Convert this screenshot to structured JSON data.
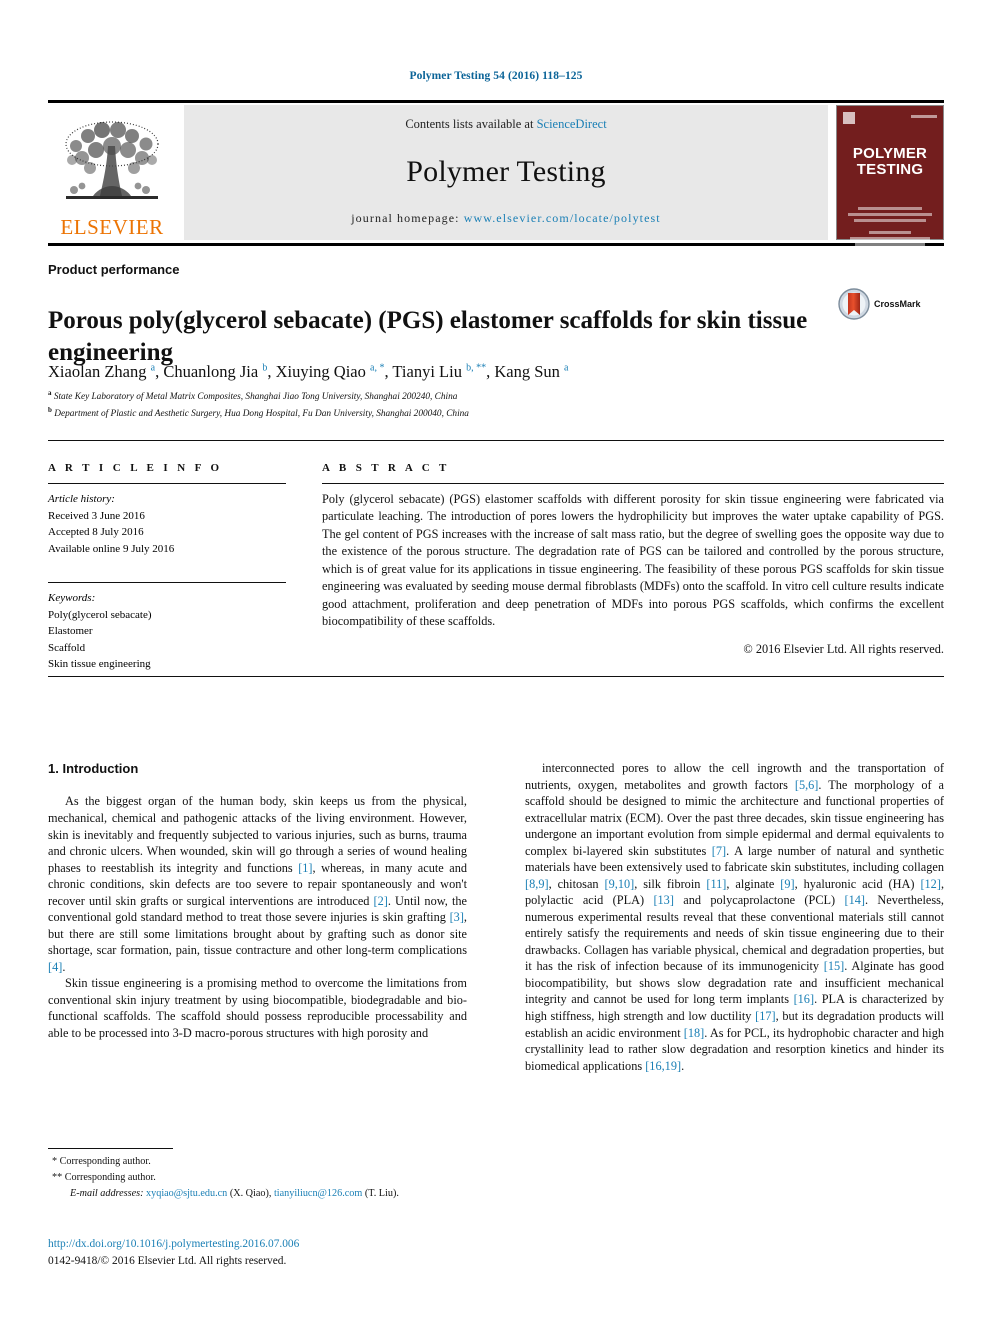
{
  "running_head": "Polymer Testing 54 (2016) 118–125",
  "masthead": {
    "contents_prefix": "Contents lists available at ",
    "contents_link": "ScienceDirect",
    "journal_name": "Polymer Testing",
    "homepage_prefix": "journal homepage: ",
    "homepage_url": "www.elsevier.com/locate/polytest",
    "publisher_name": "ELSEVIER",
    "cover_title_line1": "POLYMER",
    "cover_title_line2": "TESTING"
  },
  "section_label": "Product performance",
  "title": "Porous poly(glycerol sebacate) (PGS) elastomer scaffolds for skin tissue engineering",
  "crossmark_label": "CrossMark",
  "authors": [
    {
      "name": "Xiaolan Zhang",
      "marks": "a"
    },
    {
      "name": "Chuanlong Jia",
      "marks": "b"
    },
    {
      "name": "Xiuying Qiao",
      "marks": "a, *"
    },
    {
      "name": "Tianyi Liu",
      "marks": "b, **"
    },
    {
      "name": "Kang Sun",
      "marks": "a"
    }
  ],
  "affiliations": [
    {
      "mark": "a",
      "text": "State Key Laboratory of Metal Matrix Composites, Shanghai Jiao Tong University, Shanghai 200240, China"
    },
    {
      "mark": "b",
      "text": "Department of Plastic and Aesthetic Surgery, Hua Dong Hospital, Fu Dan University, Shanghai 200040, China"
    }
  ],
  "article_info": {
    "heading": "A R T I C L E  I N F O",
    "history_label": "Article history:",
    "history": [
      "Received 3 June 2016",
      "Accepted 8 July 2016",
      "Available online 9 July 2016"
    ],
    "keywords_label": "Keywords:",
    "keywords": [
      "Poly(glycerol sebacate)",
      "Elastomer",
      "Scaffold",
      "Skin tissue engineering"
    ]
  },
  "abstract": {
    "heading": "A B S T R A C T",
    "text": "Poly (glycerol sebacate) (PGS) elastomer scaffolds with different porosity for skin tissue engineering were fabricated via particulate leaching. The introduction of pores lowers the hydrophilicity but improves the water uptake capability of PGS. The gel content of PGS increases with the increase of salt mass ratio, but the degree of swelling goes the opposite way due to the existence of the porous structure. The degradation rate of PGS can be tailored and controlled by the porous structure, which is of great value for its applications in tissue engineering. The feasibility of these porous PGS scaffolds for skin tissue engineering was evaluated by seeding mouse dermal fibroblasts (MDFs) onto the scaffold. In vitro cell culture results indicate good attachment, proliferation and deep penetration of MDFs into porous PGS scaffolds, which confirms the excellent biocompatibility of these scaffolds.",
    "copyright": "© 2016 Elsevier Ltd. All rights reserved."
  },
  "body": {
    "section_heading": "1. Introduction",
    "left_paragraphs": [
      "As the biggest organ of the human body, skin keeps us from the physical, mechanical, chemical and pathogenic attacks of the living environment. However, skin is inevitably and frequently subjected to various injuries, such as burns, trauma and chronic ulcers. When wounded, skin will go through a series of wound healing phases to reestablish its integrity and functions [1], whereas, in many acute and chronic conditions, skin defects are too severe to repair spontaneously and won't recover until skin grafts or surgical interventions are introduced [2]. Until now, the conventional gold standard method to treat those severe injuries is skin grafting [3], but there are still some limitations brought about by grafting such as donor site shortage, scar formation, pain, tissue contracture and other long-term complications [4].",
      "Skin tissue engineering is a promising method to overcome the limitations from conventional skin injury treatment by using biocompatible, biodegradable and bio-functional scaffolds. The scaffold should possess reproducible processability and able to be processed into 3-D macro-porous structures with high porosity and"
    ],
    "right_paragraphs": [
      "interconnected pores to allow the cell ingrowth and the transportation of nutrients, oxygen, metabolites and growth factors [5,6]. The morphology of a scaffold should be designed to mimic the architecture and functional properties of extracellular matrix (ECM). Over the past three decades, skin tissue engineering has undergone an important evolution from simple epidermal and dermal equivalents to complex bi-layered skin substitutes [7]. A large number of natural and synthetic materials have been extensively used to fabricate skin substitutes, including collagen [8,9], chitosan [9,10], silk fibroin [11], alginate [9], hyaluronic acid (HA) [12], polylactic acid (PLA) [13] and polycaprolactone (PCL) [14]. Nevertheless, numerous experimental results reveal that these conventional materials still cannot entirely satisfy the requirements and needs of skin tissue engineering due to their drawbacks. Collagen has variable physical, chemical and degradation properties, but it has the risk of infection because of its immunogenicity [15]. Alginate has good biocompatibility, but shows slow degradation rate and insufficient mechanical integrity and cannot be used for long term implants [16]. PLA is characterized by high stiffness, high strength and low ductility [17], but its degradation products will establish an acidic environment [18]. As for PCL, its hydrophobic character and high crystallinity lead to rather slow degradation and resorption kinetics and hinder its biomedical applications [16,19]."
    ]
  },
  "footnotes": {
    "corresponding_1": "* Corresponding author.",
    "corresponding_2": "** Corresponding author.",
    "email_label": "E-mail addresses:",
    "email_1": "xyqiao@sjtu.edu.cn",
    "email_1_owner": "(X. Qiao),",
    "email_2": "tianyiliucn@126.com",
    "email_2_owner": "(T. Liu)."
  },
  "doi": {
    "url": "http://dx.doi.org/10.1016/j.polymertesting.2016.07.006",
    "issn": "0142-9418/© 2016 Elsevier Ltd. All rights reserved."
  },
  "colors": {
    "link": "#1a7fb5",
    "running_head": "#0b6498",
    "elsevier_orange": "#ec7404",
    "cover_maroon": "#731e1e",
    "masthead_gray": "#e8e8e8"
  }
}
